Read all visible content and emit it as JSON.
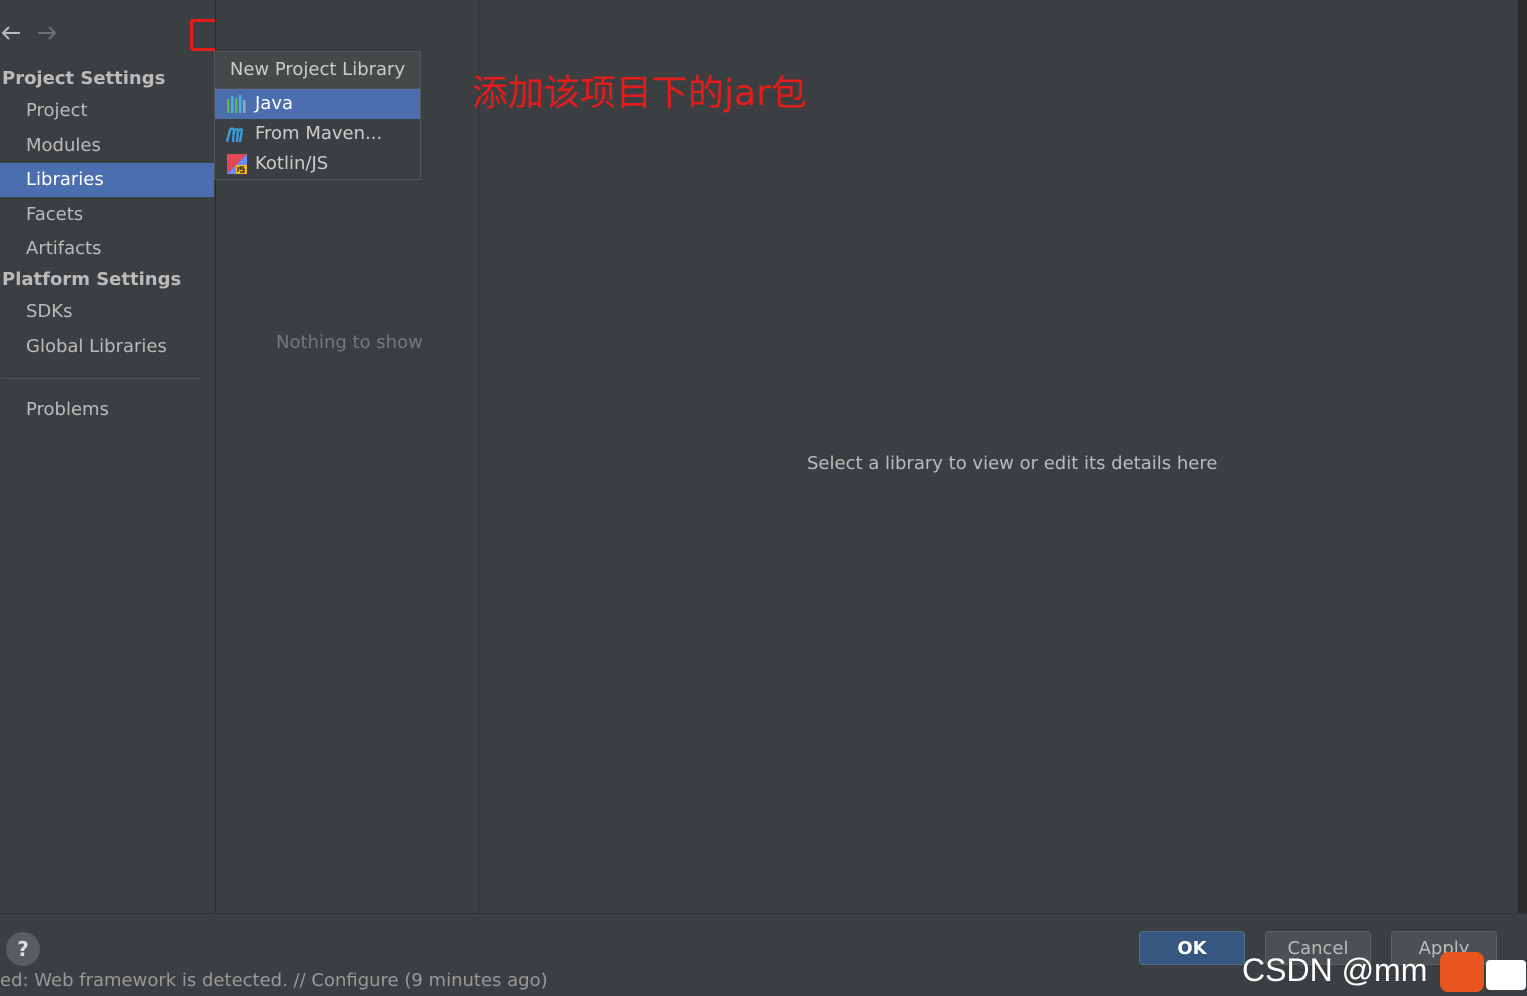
{
  "nav": {
    "project_settings": "Project Settings",
    "project": "Project",
    "modules": "Modules",
    "libraries": "Libraries",
    "facets": "Facets",
    "artifacts": "Artifacts",
    "platform_settings": "Platform Settings",
    "sdks": "SDKs",
    "global_libraries": "Global Libraries",
    "problems": "Problems"
  },
  "list": {
    "empty_text": "Nothing to show"
  },
  "popup": {
    "title": "New Project Library",
    "items": [
      "Java",
      "From Maven...",
      "Kotlin/JS"
    ]
  },
  "annotation": "添加该项目下的jar包",
  "detail": {
    "empty_text": "Select a library to view or edit its details here"
  },
  "buttons": {
    "ok": "OK",
    "cancel": "Cancel",
    "apply": "Apply",
    "help": "?"
  },
  "status": "ed: Web framework is detected. // Configure (9 minutes ago)",
  "watermark": "CSDN @mm",
  "colors": {
    "selection": "#4b6eaf",
    "annotation": "#e51c1c",
    "ok_button": "#365880"
  }
}
